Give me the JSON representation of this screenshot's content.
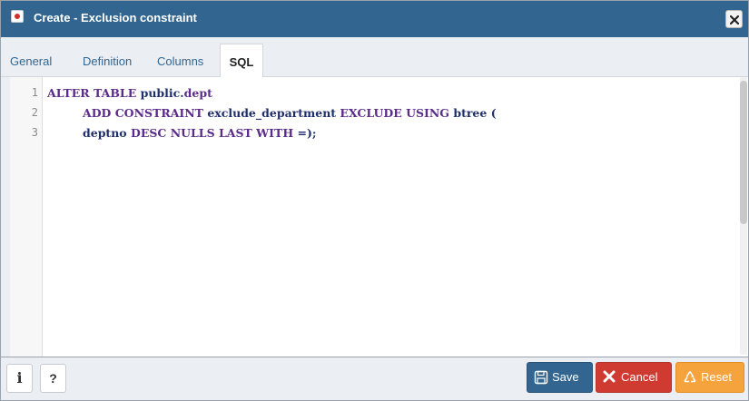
{
  "dialog": {
    "title": "Create - Exclusion constraint",
    "close_icon": "close-icon",
    "app_icon": "exclusion-constraint-icon"
  },
  "tabs": [
    {
      "label": "General",
      "active": false
    },
    {
      "label": "Definition",
      "active": false
    },
    {
      "label": "Columns",
      "active": false
    },
    {
      "label": "SQL",
      "active": true
    }
  ],
  "editor": {
    "lines": [
      {
        "number": "1",
        "tokens": [
          "ALTER TABLE",
          " public.",
          "dept"
        ]
      },
      {
        "number": "2",
        "tokens": [
          "ADD CONSTRAINT",
          " exclude_department ",
          "EXCLUDE USING",
          " btree ("
        ]
      },
      {
        "number": "3",
        "tokens": [
          "deptno ",
          "DESC NULLS LAST WITH",
          " =);"
        ]
      }
    ]
  },
  "footer": {
    "info_label": "i",
    "help_label": "?",
    "save_label": "Save",
    "cancel_label": "Cancel",
    "reset_label": "Reset"
  },
  "colors": {
    "titlebar": "#326690",
    "save": "#326690",
    "cancel": "#cf3b30",
    "reset": "#f5a33d",
    "keyword": "#5b2c8a"
  }
}
